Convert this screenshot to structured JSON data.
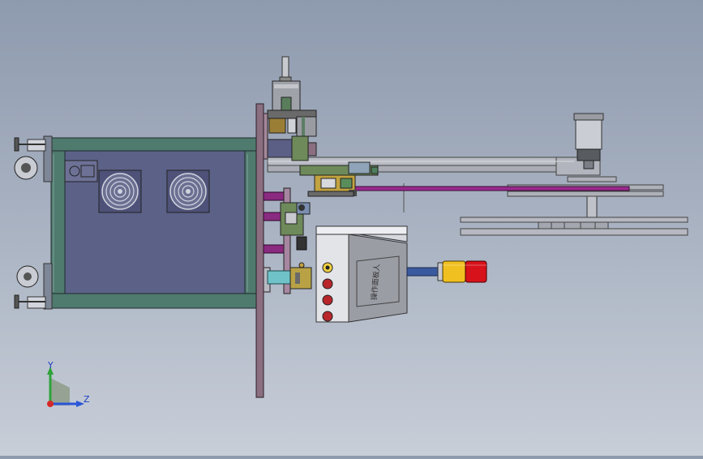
{
  "viewport": {
    "background_top": "#8e9aae",
    "background_bottom": "#c8ced8"
  },
  "model": {
    "name": "machine-assembly-side-view",
    "colors": {
      "frame": "#4f7a6e",
      "frame_panel": "#5a5f88",
      "plate": "#8b6f80",
      "beam": "#b9bcc4",
      "belt": "#9a2a8e",
      "cabinet": "#8f9096",
      "fan_grill": "#c6c9d4",
      "shaft": "#6fc3c8",
      "beacon_yellow": "#f0c020",
      "beacon_red": "#d8121a"
    },
    "control_panel_label": "操作面板人",
    "beacon_icon": "signal-tower-icon"
  },
  "triad": {
    "y_label": "Y",
    "z_label": "Z"
  }
}
